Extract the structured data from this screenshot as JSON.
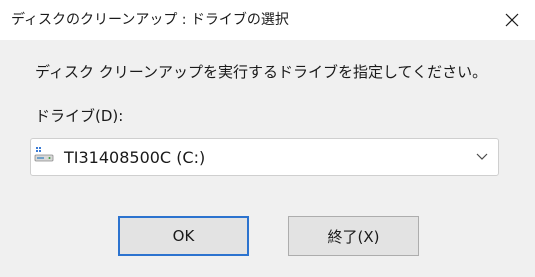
{
  "window": {
    "title": "ディスクのクリーンアップ : ドライブの選択"
  },
  "dialog": {
    "instruction": "ディスク クリーンアップを実行するドライブを指定してください。",
    "drive_label": "ドライブ(D):",
    "drive_select": {
      "value": "TI31408500C (C:)"
    },
    "buttons": {
      "ok_label": "OK",
      "exit_label": "終了(X)"
    }
  },
  "icons": {
    "close": "close-icon",
    "drive": "drive-icon",
    "dropdown": "chevron-down-icon"
  },
  "colors": {
    "background": "#f0f0f0",
    "titlebar": "#ffffff",
    "default_button_border": "#2c73cf"
  }
}
